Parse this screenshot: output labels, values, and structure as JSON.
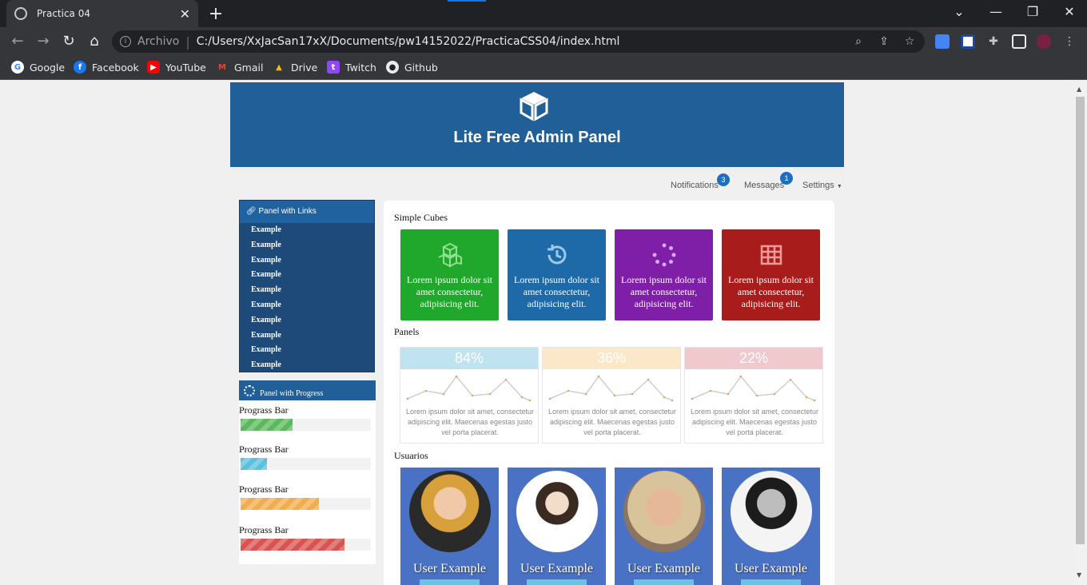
{
  "browser": {
    "tab_title": "Practica 04",
    "omnibox_prefix": "Archivo",
    "url": "C:/Users/XxJacSan17xX/Documents/pw14152022/PracticaCSS04/index.html",
    "bookmarks": [
      "Google",
      "Facebook",
      "YouTube",
      "Gmail",
      "Drive",
      "Twitch",
      "Github"
    ]
  },
  "header": {
    "title": "Lite Free Admin Panel",
    "icon": "cube-icon"
  },
  "topnav": {
    "notifications": "Notifications",
    "notifications_count": "3",
    "messages": "Messages",
    "messages_count": "1",
    "settings": "Settings"
  },
  "links_panel": {
    "title": "Panel with Links",
    "items": [
      "Example",
      "Example",
      "Example",
      "Example",
      "Example",
      "Example",
      "Example",
      "Example",
      "Example",
      "Example"
    ]
  },
  "progress_panel": {
    "title": "Panel with Progress",
    "bars": [
      {
        "label": "Prograss Bar",
        "value": 0.4,
        "color": "#5cb85c"
      },
      {
        "label": "Prograss Bar",
        "value": 0.2,
        "color": "#5bc0de"
      },
      {
        "label": "Prograss Bar",
        "value": 0.6,
        "color": "#f0ad4e"
      },
      {
        "label": "Prograss Bar",
        "value": 0.8,
        "color": "#d9534f"
      }
    ]
  },
  "sections": {
    "cubes": "Simple Cubes",
    "panels": "Panels",
    "users": "Usuarios"
  },
  "cubes": [
    {
      "text": "Lorem ipsum dolor sit amet consectetur, adipisicing elit.",
      "color": "#1fa82b",
      "icon": "cubes-icon"
    },
    {
      "text": "Lorem ipsum dolor sit amet consectetur, adipisicing elit.",
      "color": "#1e6aa8",
      "icon": "history-icon"
    },
    {
      "text": "Lorem ipsum dolor sit amet consectetur, adipisicing elit.",
      "color": "#7f1fa8",
      "icon": "spinner-icon"
    },
    {
      "text": "Lorem ipsum dolor sit amet consectetur, adipisicing elit.",
      "color": "#a81c1c",
      "icon": "table-icon"
    }
  ],
  "stats": [
    {
      "value": "84%",
      "color": "#bfe4f0",
      "text": "Lorem ipsum dolor sit amet, consectetur adipiscing elit. Maecenas egestas justo vel porta placerat."
    },
    {
      "value": "36%",
      "color": "#fbe8c8",
      "text": "Lorem ipsum dolor sit amet, consectetur adipiscing elit. Maecenas egestas justo vel porta placerat."
    },
    {
      "value": "22%",
      "color": "#efc9cd",
      "text": "Lorem ipsum dolor sit amet, consectetur adipiscing elit. Maecenas egestas justo vel porta placerat."
    }
  ],
  "users": [
    {
      "name": "User Example"
    },
    {
      "name": "User Example"
    },
    {
      "name": "User Example"
    },
    {
      "name": "User Example"
    }
  ]
}
